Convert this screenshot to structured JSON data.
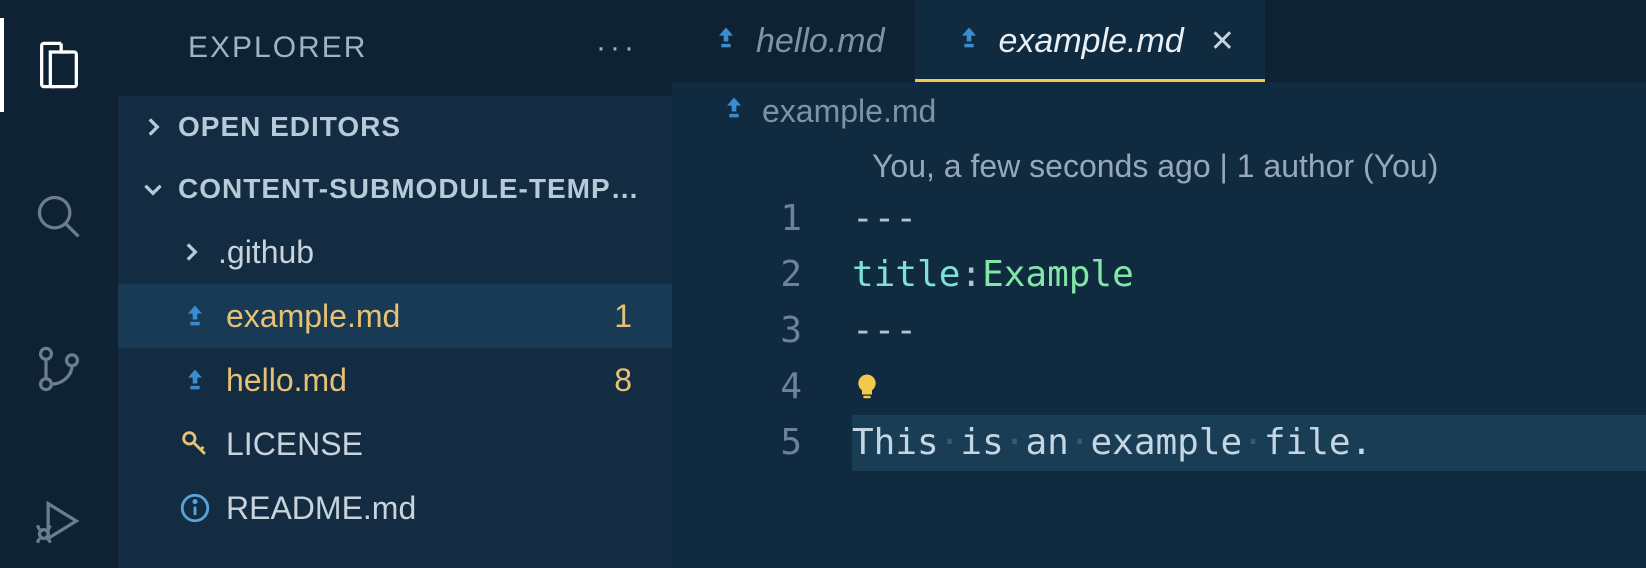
{
  "activityBar": {
    "items": [
      {
        "name": "explorer",
        "active": true
      },
      {
        "name": "search",
        "active": false
      },
      {
        "name": "source-control",
        "active": false
      },
      {
        "name": "run-debug",
        "active": false
      }
    ]
  },
  "sidebar": {
    "title": "EXPLORER",
    "sections": {
      "openEditors": {
        "label": "OPEN EDITORS",
        "expanded": false
      },
      "workspace": {
        "label": "CONTENT-SUBMODULE-TEMP…",
        "expanded": true
      }
    },
    "tree": [
      {
        "type": "folder",
        "label": ".github",
        "expanded": false
      },
      {
        "type": "file",
        "label": "example.md",
        "modified": true,
        "badge": "1",
        "selected": true,
        "icon": "arrow"
      },
      {
        "type": "file",
        "label": "hello.md",
        "modified": true,
        "badge": "8",
        "icon": "arrow"
      },
      {
        "type": "file",
        "label": "LICENSE",
        "icon": "key"
      },
      {
        "type": "file",
        "label": "README.md",
        "icon": "info"
      }
    ]
  },
  "tabs": [
    {
      "label": "hello.md",
      "active": false
    },
    {
      "label": "example.md",
      "active": true,
      "hasClose": true
    }
  ],
  "breadcrumb": {
    "file": "example.md"
  },
  "codelens": "You, a few seconds ago | 1 author (You)",
  "lines": [
    {
      "n": "1",
      "content": [
        {
          "t": "---",
          "cls": "tok-punc"
        }
      ]
    },
    {
      "n": "2",
      "content": [
        {
          "t": "title",
          "cls": "tok-key"
        },
        {
          "t": ":",
          "cls": "tok-punc"
        },
        {
          "t": " ",
          "cls": ""
        },
        {
          "t": "Example",
          "cls": "tok-val"
        }
      ]
    },
    {
      "n": "3",
      "content": [
        {
          "t": "---",
          "cls": "tok-punc"
        }
      ]
    },
    {
      "n": "4",
      "bulb": true,
      "content": []
    },
    {
      "n": "5",
      "current": true,
      "text": "This is an example file.",
      "words": [
        "This",
        "is",
        "an",
        "example",
        "file."
      ]
    }
  ]
}
